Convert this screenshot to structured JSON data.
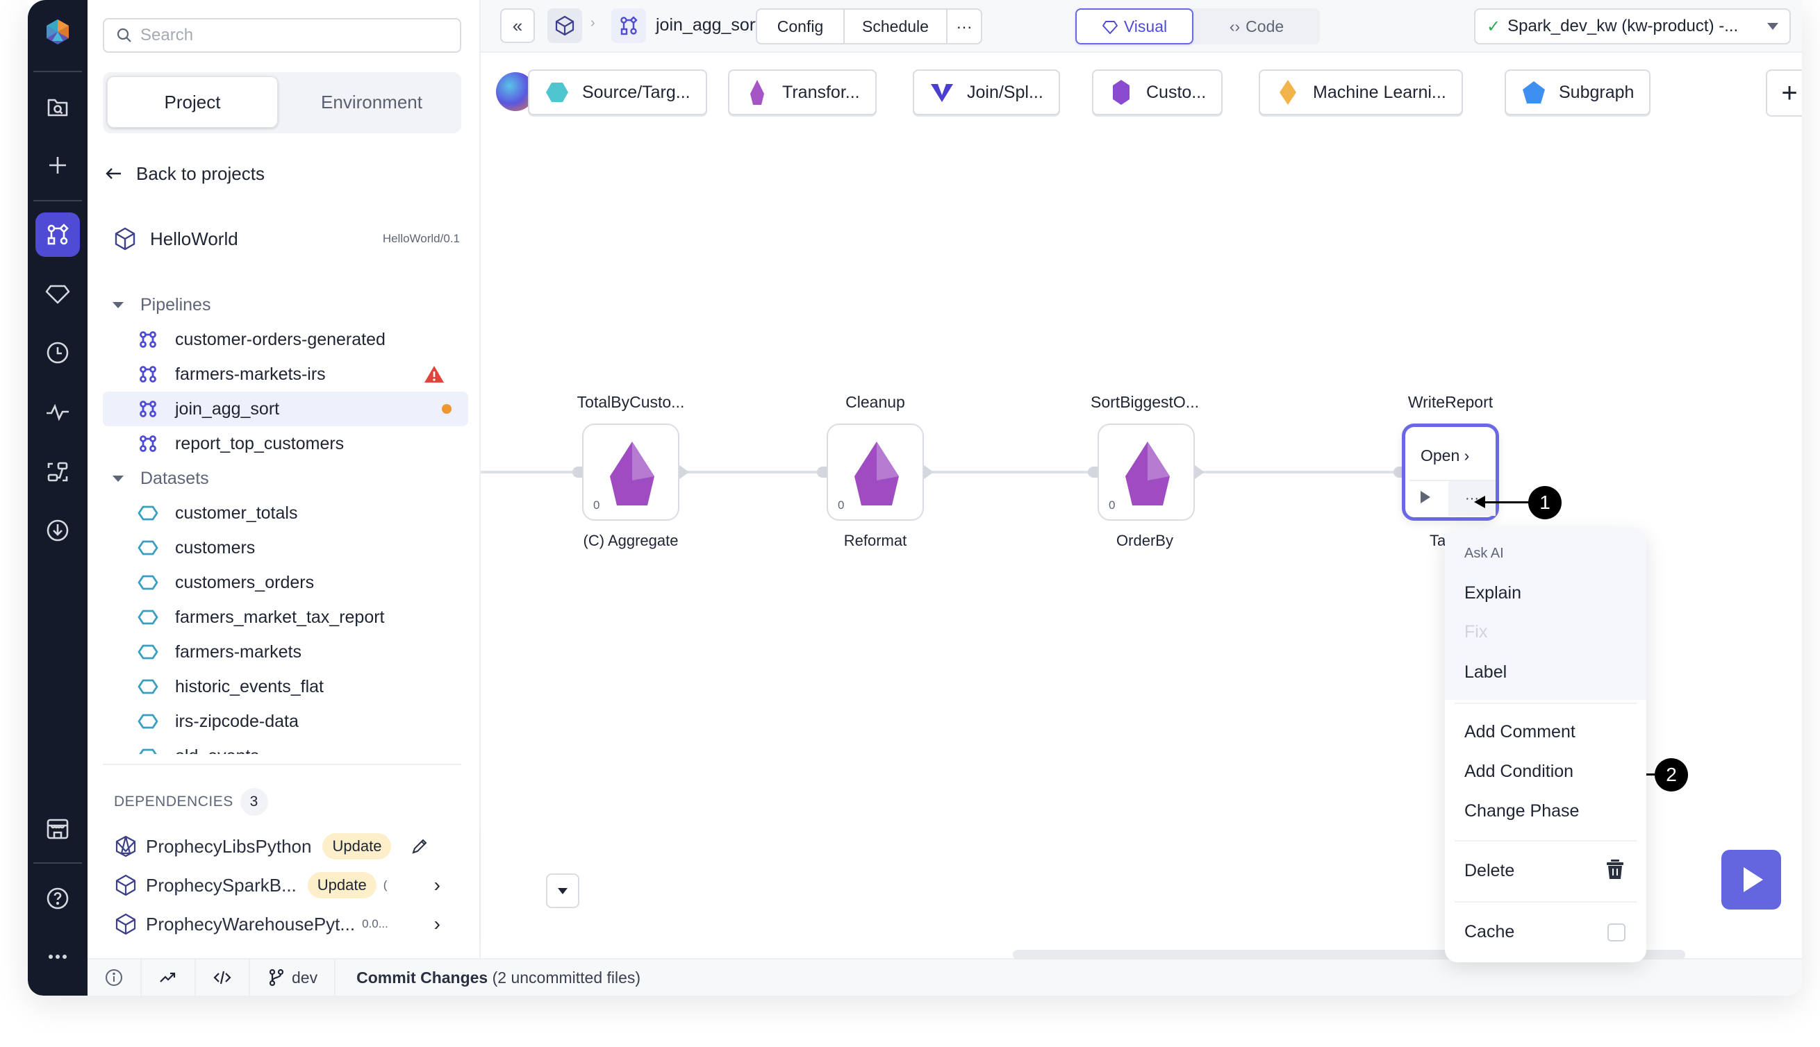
{
  "nav_rail": {
    "items": [
      {
        "icon": "prophecy-logo-icon"
      },
      {
        "icon": "folder-search-icon"
      },
      {
        "icon": "plus-icon"
      },
      {
        "icon": "pipeline-icon",
        "active": true
      },
      {
        "icon": "gem-icon"
      },
      {
        "icon": "clock-icon"
      },
      {
        "icon": "activity-icon"
      },
      {
        "icon": "lineage-icon"
      },
      {
        "icon": "download-circle-icon"
      },
      {
        "icon": "marketplace-icon"
      },
      {
        "icon": "help-icon"
      },
      {
        "icon": "more-icon"
      }
    ],
    "accent": "#4f4bd4"
  },
  "sidebar": {
    "search_placeholder": "Search",
    "tabs": [
      {
        "label": "Project",
        "selected": true
      },
      {
        "label": "Environment",
        "selected": false
      }
    ],
    "back_label": "Back to projects",
    "project": {
      "name": "HelloWorld",
      "version": "HelloWorld/0.1"
    },
    "pipelines_label": "Pipelines",
    "pipelines": [
      {
        "name": "customer-orders-generated"
      },
      {
        "name": "farmers-markets-irs",
        "status": "warning"
      },
      {
        "name": "join_agg_sort",
        "selected": true,
        "status": "modified"
      },
      {
        "name": "report_top_customers"
      }
    ],
    "datasets_label": "Datasets",
    "datasets": [
      {
        "name": "customer_totals"
      },
      {
        "name": "customers"
      },
      {
        "name": "customers_orders"
      },
      {
        "name": "farmers_market_tax_report"
      },
      {
        "name": "farmers-markets"
      },
      {
        "name": "historic_events_flat"
      },
      {
        "name": "irs-zipcode-data"
      },
      {
        "name": "old_events"
      }
    ],
    "dependencies": {
      "title": "DEPENDENCIES",
      "count": "3",
      "items": [
        {
          "name": "ProphecyLibsPython",
          "badge": "Update"
        },
        {
          "name": "ProphecySparkB...",
          "badge": "Update",
          "version": "("
        },
        {
          "name": "ProphecyWarehousePyt...",
          "version": "0.0..."
        }
      ]
    }
  },
  "status_bar": {
    "branch": "dev",
    "commit_label": "Commit Changes",
    "commit_detail": "(2 uncommitted files)"
  },
  "topbar": {
    "pipeline_name": "join_agg_sort",
    "config_label": "Config",
    "schedule_label": "Schedule",
    "more_label": "···",
    "visual_label": "Visual",
    "code_label": "Code",
    "fabric_label": "Spark_dev_kw (kw-product)  -...",
    "collapse_label": "«"
  },
  "gem_bar": {
    "categories": [
      {
        "label": "Source/Targ...",
        "color": "#4fc6cf"
      },
      {
        "label": "Transfor...",
        "color": "#a655c4"
      },
      {
        "label": "Join/Spl...",
        "color": "#4b3fd0"
      },
      {
        "label": "Custo...",
        "color": "#8a4bd0"
      },
      {
        "label": "Machine Learni...",
        "color": "#f0b44a"
      },
      {
        "label": "Subgraph",
        "color": "#3d8ff0"
      }
    ],
    "add_label": "+"
  },
  "canvas": {
    "nodes": [
      {
        "title": "TotalByCusto...",
        "type": "(C) Aggregate",
        "count": "0"
      },
      {
        "title": "Cleanup",
        "type": "Reformat",
        "count": "0"
      },
      {
        "title": "SortBiggestO...",
        "type": "OrderBy",
        "count": "0"
      },
      {
        "title": "WriteReport",
        "type": "Ta",
        "open_label": "Open ›",
        "more_label": "···",
        "selected": true
      }
    ],
    "callouts": [
      "1",
      "2"
    ]
  },
  "context_menu": {
    "ask_ai_header": "Ask AI",
    "items": [
      {
        "label": "Explain"
      },
      {
        "label": "Fix",
        "disabled": true
      },
      {
        "label": "Label"
      },
      {
        "label": "Add Comment"
      },
      {
        "label": "Add Condition"
      },
      {
        "label": "Change Phase"
      },
      {
        "label": "Delete"
      },
      {
        "label": "Cache",
        "checked": false
      }
    ]
  }
}
